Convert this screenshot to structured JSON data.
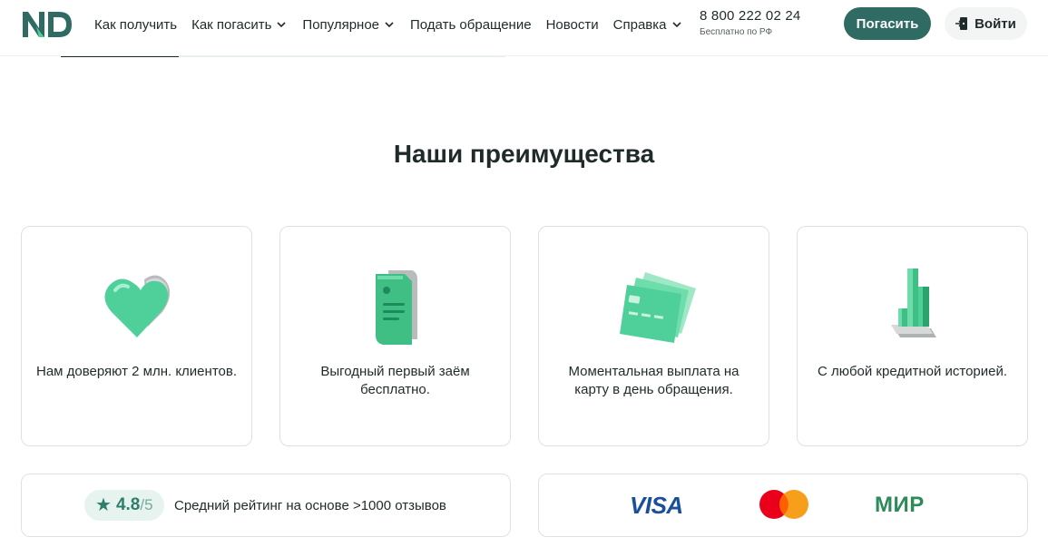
{
  "header": {
    "logo_text": "ND",
    "nav": [
      {
        "label": "Как получить",
        "has_dropdown": false
      },
      {
        "label": "Как погасить",
        "has_dropdown": true
      },
      {
        "label": "Популярное",
        "has_dropdown": true
      },
      {
        "label": "Подать обращение",
        "has_dropdown": false
      },
      {
        "label": "Новости",
        "has_dropdown": false
      },
      {
        "label": "Справка",
        "has_dropdown": true
      }
    ],
    "phone": "8 800 222 02 24",
    "phone_note": "Бесплатно по РФ",
    "pay_button": "Погасить",
    "login_button": "Войти"
  },
  "advantages": {
    "title": "Наши преимущества",
    "cards": [
      {
        "icon": "heart-icon",
        "text": "Нам доверяют 2 млн. клиентов."
      },
      {
        "icon": "document-icon",
        "text": "Выгодный первый заём бесплатно."
      },
      {
        "icon": "cards-icon",
        "text": "Моментальная выплата на карту в день обращения."
      },
      {
        "icon": "chart-icon",
        "text": "С любой кредитной историей."
      }
    ]
  },
  "rating": {
    "value": "4.8",
    "max": "/5",
    "text": "Средний рейтинг на основе >1000 отзывов"
  },
  "payment_systems": {
    "visa": "VISA",
    "mastercard": "mastercard",
    "mir": "МИР"
  },
  "colors": {
    "brand": "#2f6b63",
    "accent_green": "#4fcf9a",
    "visa": "#1a4f9c",
    "mir": "#2d8b5a",
    "mc_red": "#eb001b",
    "mc_orange": "#f79e1b"
  }
}
